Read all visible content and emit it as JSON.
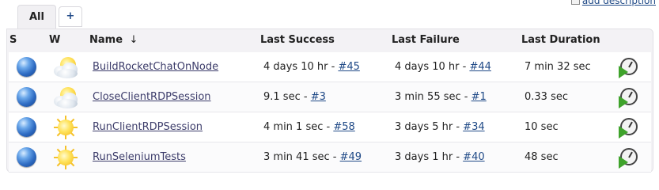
{
  "top_link": {
    "label": "add description"
  },
  "tabs": [
    {
      "label": "All"
    },
    {
      "label": "+"
    }
  ],
  "columns": {
    "status": "S",
    "weather": "W",
    "name": "Name",
    "sort_indicator": "↓",
    "last_success": "Last Success",
    "last_failure": "Last Failure",
    "last_duration": "Last Duration"
  },
  "jobs": [
    {
      "name": "BuildRocketChatOnNode",
      "status_icon": "blue-ball-icon",
      "weather_icon": "sun-behind-clouds-icon",
      "last_success_time": "4 days 10 hr - ",
      "last_success_build": "#45",
      "last_failure_time": "4 days 10 hr - ",
      "last_failure_build": "#44",
      "last_duration": "7 min 32 sec"
    },
    {
      "name": "CloseClientRDPSession",
      "status_icon": "blue-ball-icon",
      "weather_icon": "sun-behind-clouds-icon",
      "last_success_time": "9.1 sec - ",
      "last_success_build": "#3",
      "last_failure_time": "3 min 55 sec - ",
      "last_failure_build": "#1",
      "last_duration": "0.33 sec"
    },
    {
      "name": "RunClientRDPSession",
      "status_icon": "blue-ball-icon",
      "weather_icon": "sunny-icon",
      "last_success_time": "4 min 1 sec - ",
      "last_success_build": "#58",
      "last_failure_time": "3 days 5 hr - ",
      "last_failure_build": "#34",
      "last_duration": "10 sec"
    },
    {
      "name": "RunSeleniumTests",
      "status_icon": "blue-ball-icon",
      "weather_icon": "sunny-icon",
      "last_success_time": "3 min 41 sec - ",
      "last_success_build": "#49",
      "last_failure_time": "3 days 1 hr - ",
      "last_failure_build": "#40",
      "last_duration": "48 sec"
    }
  ],
  "colors": {
    "link": "#204a87",
    "panel_bg": "#f3f2f5",
    "build_arrow": "#3fa32b"
  }
}
